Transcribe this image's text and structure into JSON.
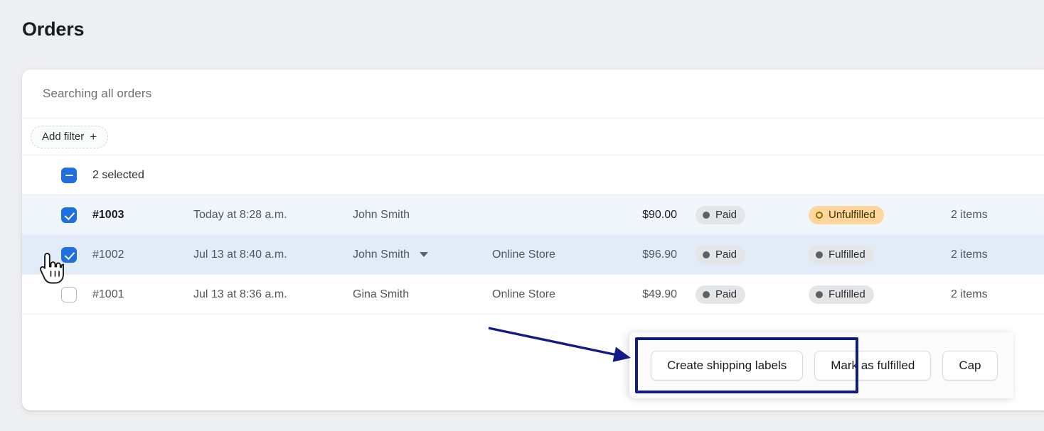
{
  "page": {
    "title": "Orders",
    "background_color": "#eeeff1"
  },
  "search": {
    "placeholder": "Searching all orders",
    "value": "Searching all orders"
  },
  "filters": {
    "add_filter_label": "Add filter",
    "add_filter_plus": "+"
  },
  "selection": {
    "label": "2 selected",
    "state": "indeterminate",
    "count": 2,
    "accent_color": "#1f6fde"
  },
  "table": {
    "rows": [
      {
        "checked": true,
        "order": "#1003",
        "date": "Today at 8:28 a.m.",
        "customer": "John Smith",
        "has_caret": false,
        "channel": "",
        "total": "$90.00",
        "payment": {
          "label": "Paid",
          "style": "grey",
          "icon": "dot-filled-icon"
        },
        "fulfillment": {
          "label": "Unfulfilled",
          "style": "amber",
          "icon": "dot-ring-icon"
        },
        "items": "2 items",
        "row_style": "sel-a"
      },
      {
        "checked": true,
        "order": "#1002",
        "date": "Jul 13 at 8:40 a.m.",
        "customer": "John Smith",
        "has_caret": true,
        "channel": "Online Store",
        "total": "$96.90",
        "payment": {
          "label": "Paid",
          "style": "grey",
          "icon": "dot-filled-icon"
        },
        "fulfillment": {
          "label": "Fulfilled",
          "style": "grey",
          "icon": "dot-filled-icon"
        },
        "items": "2 items",
        "row_style": "sel-b"
      },
      {
        "checked": false,
        "order": "#1001",
        "date": "Jul 13 at 8:36 a.m.",
        "customer": "Gina Smith",
        "has_caret": false,
        "channel": "Online Store",
        "total": "$49.90",
        "payment": {
          "label": "Paid",
          "style": "grey",
          "icon": "dot-filled-icon"
        },
        "fulfillment": {
          "label": "Fulfilled",
          "style": "grey",
          "icon": "dot-filled-icon"
        },
        "items": "2 items",
        "row_style": "plain"
      }
    ]
  },
  "bulk_actions": {
    "buttons": [
      {
        "label": "Create shipping labels",
        "highlighted": true
      },
      {
        "label": "Mark as fulfilled",
        "highlighted": false
      },
      {
        "label": "Cap",
        "highlighted": false
      }
    ]
  },
  "annotations": {
    "highlight_color": "#121a85",
    "arrow": "points-to-create-shipping-labels",
    "box_target": "Create shipping labels"
  },
  "cursor": {
    "type": "pointing-hand",
    "over": "row-1002-checkbox"
  }
}
